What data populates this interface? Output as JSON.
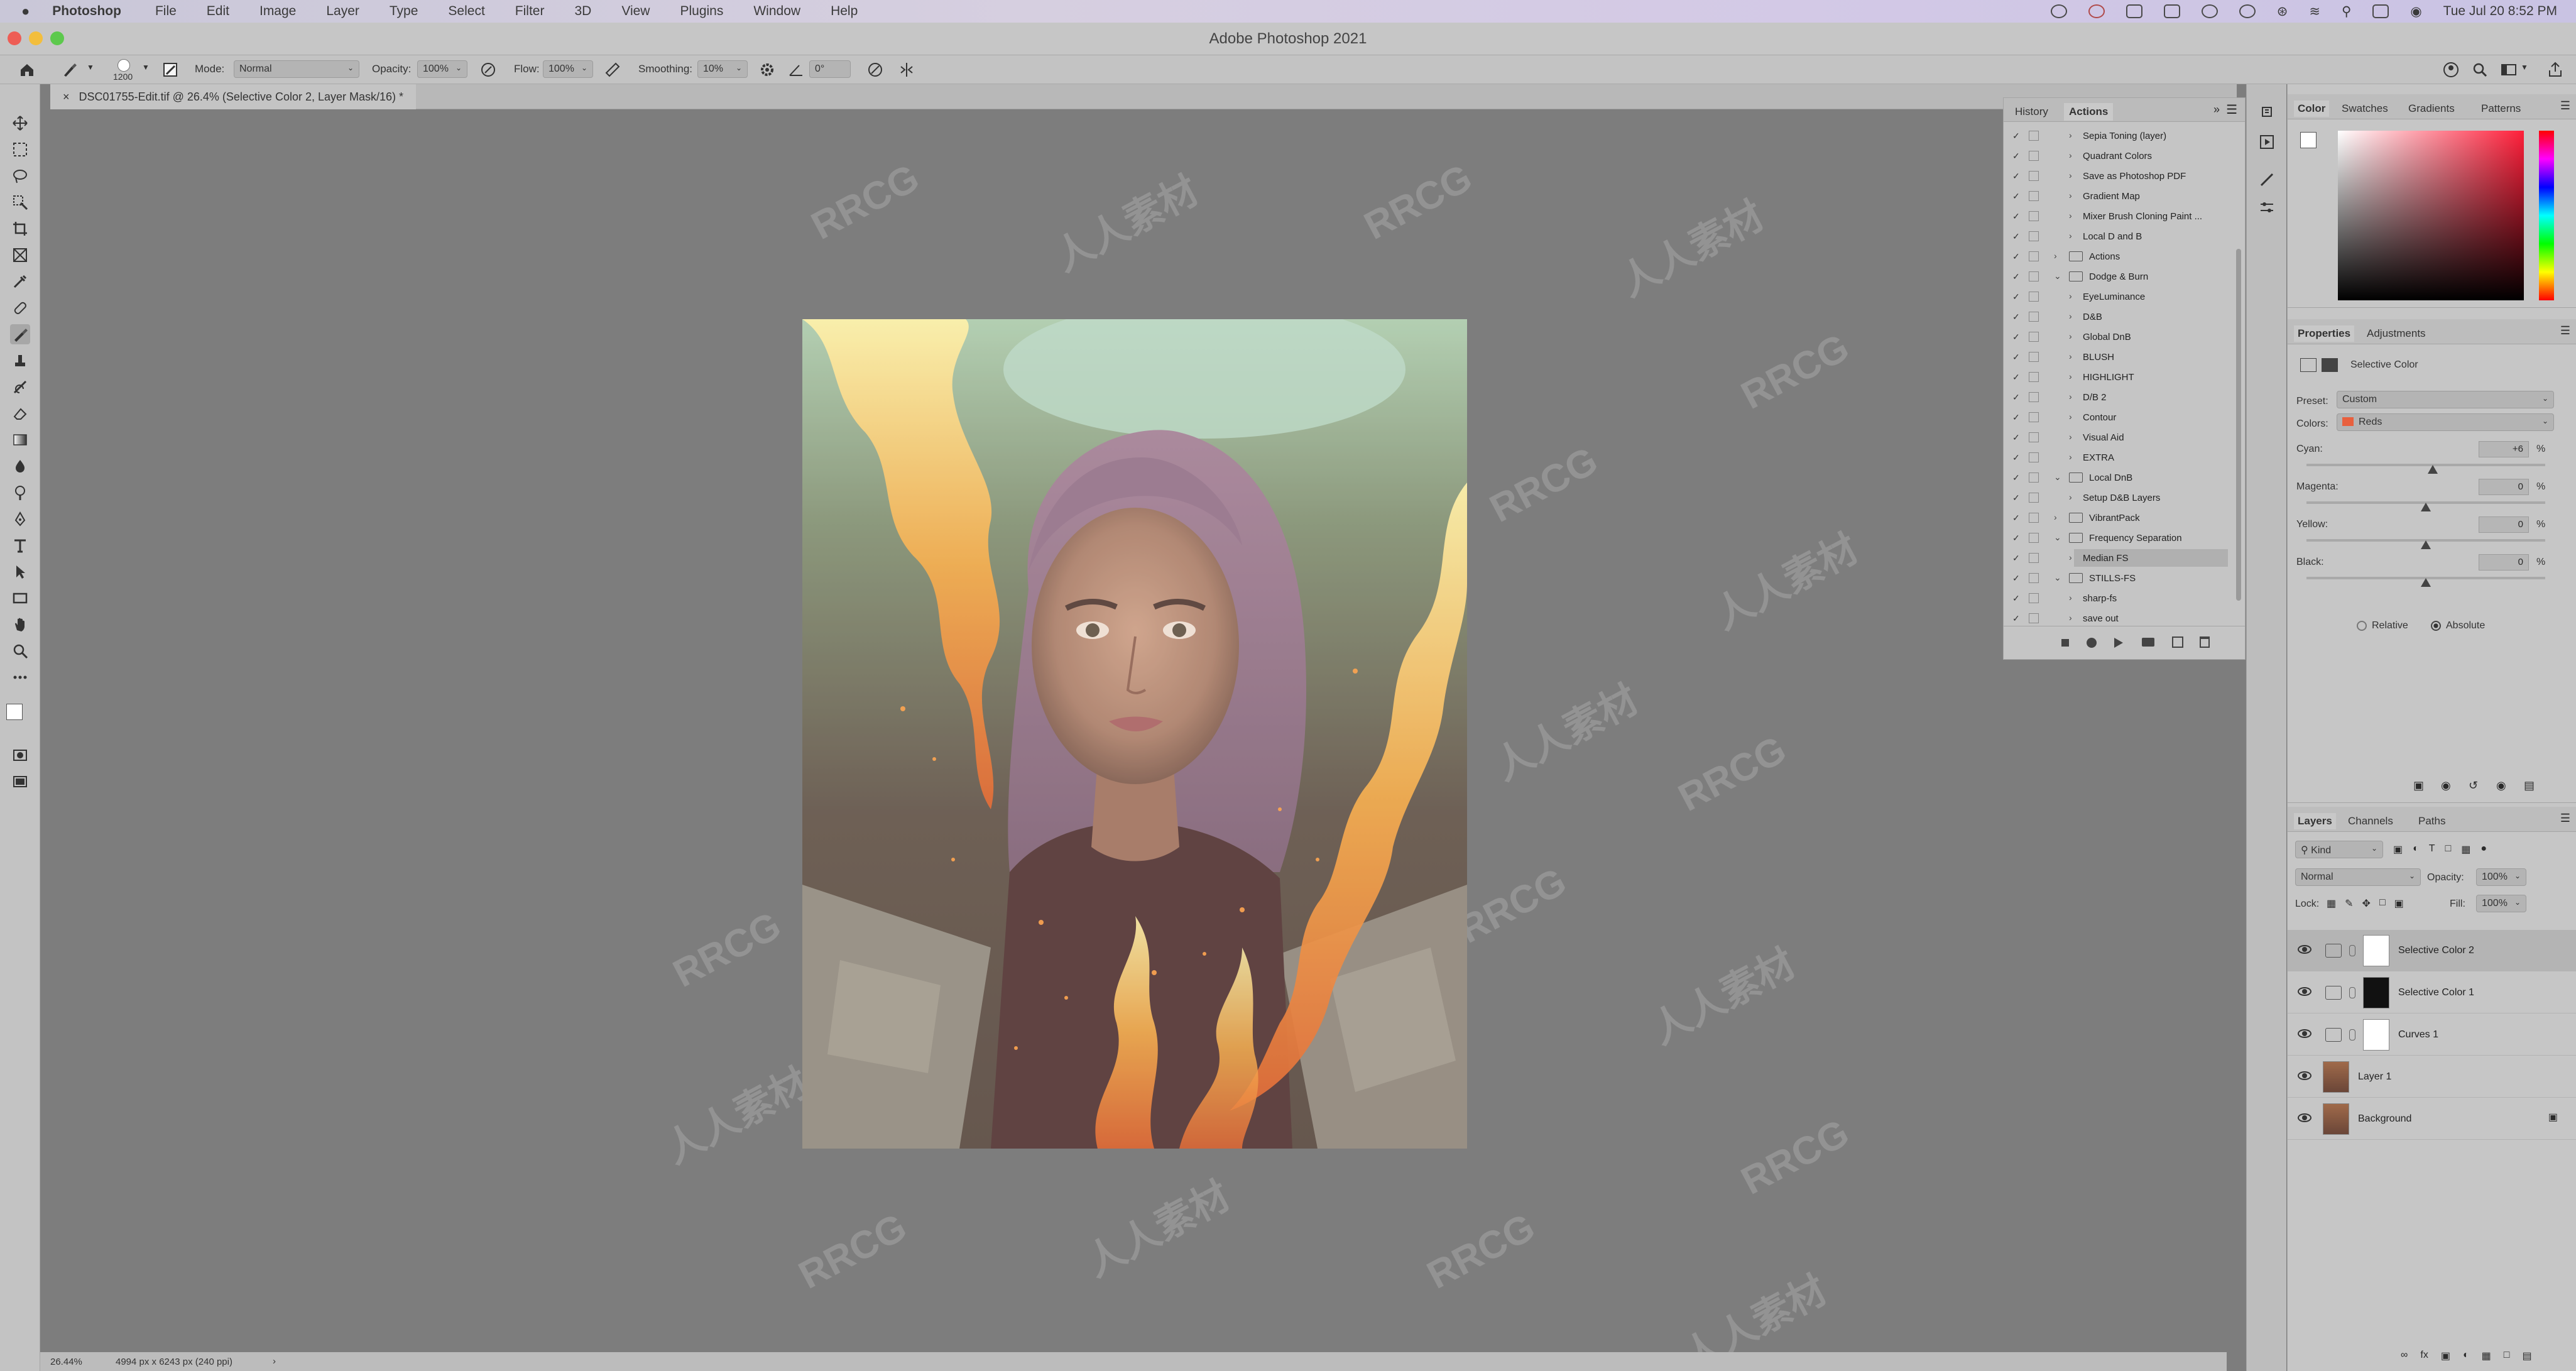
{
  "menubar": {
    "app": "Photoshop",
    "items": [
      "File",
      "Edit",
      "Image",
      "Layer",
      "Type",
      "Select",
      "Filter",
      "3D",
      "View",
      "Plugins",
      "Window",
      "Help"
    ],
    "clock": "Tue Jul 20  8:52 PM"
  },
  "window": {
    "title": "Adobe Photoshop 2021"
  },
  "options": {
    "brush_size": "1200",
    "mode_label": "Mode:",
    "mode_value": "Normal",
    "opacity_label": "Opacity:",
    "opacity_value": "100%",
    "flow_label": "Flow:",
    "flow_value": "100%",
    "smoothing_label": "Smoothing:",
    "smoothing_value": "10%",
    "angle_value": "0°"
  },
  "document": {
    "tab_title": "DSC01755-Edit.tif @ 26.4% (Selective Color 2, Layer Mask/16) *"
  },
  "status": {
    "zoom": "26.44%",
    "doc_info": "4994 px x 6243 px (240 ppi)"
  },
  "actions_panel": {
    "tabs": [
      "History",
      "Actions"
    ],
    "items": [
      {
        "label": "Sepia Toning (layer)",
        "indent": 1
      },
      {
        "label": "Quadrant Colors",
        "indent": 1
      },
      {
        "label": "Save as Photoshop PDF",
        "indent": 1
      },
      {
        "label": "Gradient Map",
        "indent": 1
      },
      {
        "label": "Mixer Brush Cloning Paint ...",
        "indent": 1
      },
      {
        "label": "Local D and B",
        "indent": 1
      },
      {
        "label": "Actions",
        "indent": 0,
        "folder": true,
        "open": false
      },
      {
        "label": "Dodge & Burn",
        "indent": 0,
        "folder": true,
        "open": true
      },
      {
        "label": "EyeLuminance",
        "indent": 1
      },
      {
        "label": "D&B",
        "indent": 1
      },
      {
        "label": "Global DnB",
        "indent": 1
      },
      {
        "label": "BLUSH",
        "indent": 1
      },
      {
        "label": "HIGHLIGHT",
        "indent": 1
      },
      {
        "label": "D/B 2",
        "indent": 1
      },
      {
        "label": "Contour",
        "indent": 1
      },
      {
        "label": "Visual Aid",
        "indent": 1
      },
      {
        "label": "EXTRA",
        "indent": 1
      },
      {
        "label": "Local DnB",
        "indent": 0,
        "folder": true,
        "open": true
      },
      {
        "label": "Setup D&B Layers",
        "indent": 1
      },
      {
        "label": "VibrantPack",
        "indent": 0,
        "folder": true,
        "open": false
      },
      {
        "label": "Frequency Separation",
        "indent": 0,
        "folder": true,
        "open": true
      },
      {
        "label": "Median FS",
        "indent": 1,
        "selected": true
      },
      {
        "label": "STILLS-FS",
        "indent": 0,
        "folder": true,
        "open": true
      },
      {
        "label": "sharp-fs",
        "indent": 1
      },
      {
        "label": "save out",
        "indent": 1
      }
    ]
  },
  "color_panel": {
    "tabs": [
      "Color",
      "Swatches",
      "Gradients",
      "Patterns"
    ]
  },
  "properties": {
    "tabs": [
      "Properties",
      "Adjustments"
    ],
    "adjustment_name": "Selective Color",
    "preset_label": "Preset:",
    "preset_value": "Custom",
    "colors_label": "Colors:",
    "colors_value": "Reds",
    "sliders": [
      {
        "label": "Cyan:",
        "value": "+6",
        "pct": "%",
        "level": 0.53
      },
      {
        "label": "Magenta:",
        "value": "0",
        "pct": "%",
        "level": 0.5
      },
      {
        "label": "Yellow:",
        "value": "0",
        "pct": "%",
        "level": 0.5
      },
      {
        "label": "Black:",
        "value": "0",
        "pct": "%",
        "level": 0.5
      }
    ],
    "method_relative": "Relative",
    "method_absolute": "Absolute"
  },
  "layers_panel": {
    "tabs": [
      "Layers",
      "Channels",
      "Paths"
    ],
    "kind_label": "Kind",
    "blend_mode": "Normal",
    "opacity_label": "Opacity:",
    "opacity_value": "100%",
    "lock_label": "Lock:",
    "fill_label": "Fill:",
    "fill_value": "100%",
    "layers": [
      {
        "name": "Selective Color 2",
        "selected": true,
        "type": "adjustment",
        "mask": "white"
      },
      {
        "name": "Selective Color 1",
        "selected": false,
        "type": "adjustment",
        "mask": "black"
      },
      {
        "name": "Curves 1",
        "selected": false,
        "type": "curves",
        "mask": "white"
      },
      {
        "name": "Layer 1",
        "selected": false,
        "type": "pixel"
      },
      {
        "name": "Background",
        "selected": false,
        "type": "background",
        "locked": true
      }
    ]
  },
  "watermarks": [
    "RRCG",
    "人人素材"
  ]
}
